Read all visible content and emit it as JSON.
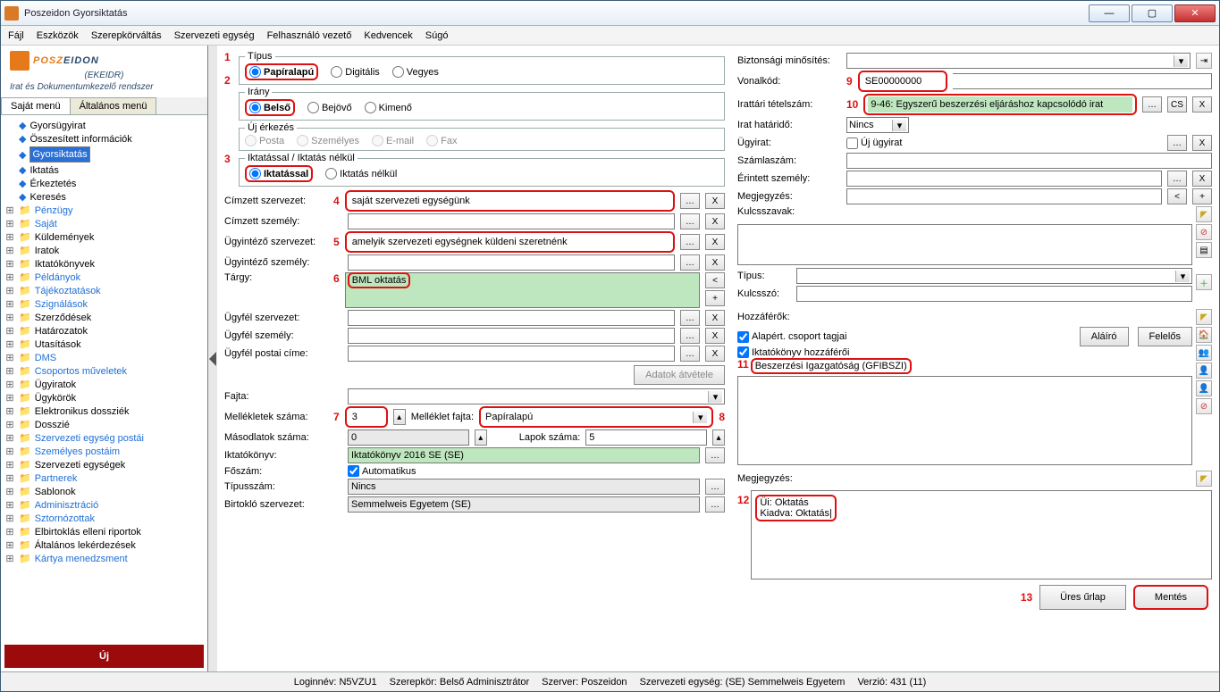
{
  "window": {
    "title": "Poszeidon Gyorsiktatás"
  },
  "menu": {
    "fajl": "Fájl",
    "eszkozok": "Eszközök",
    "szerepkor": "Szerepkörváltás",
    "szervegy": "Szervezeti egység",
    "felhvez": "Felhasználó vezető",
    "kedvenc": "Kedvencek",
    "sugo": "Súgó"
  },
  "brand": {
    "posz": "POSZ",
    "eidon": "EIDON",
    "ekeidr": "(EKEIDR)",
    "sub": "Irat és Dokumentumkezelő rendszer"
  },
  "tabs": {
    "sajat": "Saját menü",
    "alt": "Általános menü"
  },
  "tree": {
    "items": [
      {
        "exp": "",
        "icon": "dia",
        "label": "Gyorsügyirat",
        "blue": false
      },
      {
        "exp": "",
        "icon": "dia",
        "label": "Összesített információk",
        "blue": false
      },
      {
        "exp": "",
        "icon": "dia",
        "label": "Gyorsiktatás",
        "sel": true
      },
      {
        "exp": "",
        "icon": "dia",
        "label": "Iktatás",
        "blue": false
      },
      {
        "exp": "",
        "icon": "dia",
        "label": "Érkeztetés",
        "blue": false
      },
      {
        "exp": "",
        "icon": "dia",
        "label": "Keresés",
        "blue": false
      },
      {
        "exp": "+",
        "icon": "folder",
        "label": "Pénzügy",
        "blue": true
      },
      {
        "exp": "+",
        "icon": "folder",
        "label": "Saját",
        "blue": true
      },
      {
        "exp": "+",
        "icon": "folder",
        "label": "Küldemények",
        "blue": false
      },
      {
        "exp": "+",
        "icon": "folder",
        "label": "Iratok",
        "blue": false
      },
      {
        "exp": "+",
        "icon": "folder",
        "label": "Iktatókönyvek",
        "blue": false
      },
      {
        "exp": "+",
        "icon": "folder",
        "label": "Példányok",
        "blue": true
      },
      {
        "exp": "+",
        "icon": "folder",
        "label": "Tájékoztatások",
        "blue": true
      },
      {
        "exp": "+",
        "icon": "folder",
        "label": "Szignálások",
        "blue": true
      },
      {
        "exp": "+",
        "icon": "folder",
        "label": "Szerződések",
        "blue": false
      },
      {
        "exp": "+",
        "icon": "folder",
        "label": "Határozatok",
        "blue": false
      },
      {
        "exp": "+",
        "icon": "folder",
        "label": "Utasítások",
        "blue": false
      },
      {
        "exp": "+",
        "icon": "folder",
        "label": "DMS",
        "blue": true
      },
      {
        "exp": "+",
        "icon": "folder",
        "label": "Csoportos műveletek",
        "blue": true
      },
      {
        "exp": "+",
        "icon": "folder",
        "label": "Ügyiratok",
        "blue": false
      },
      {
        "exp": "+",
        "icon": "folder",
        "label": "Ügykörök",
        "blue": false
      },
      {
        "exp": "+",
        "icon": "folder",
        "label": "Elektronikus dossziék",
        "blue": false
      },
      {
        "exp": "+",
        "icon": "folder",
        "label": "Dosszié",
        "blue": false
      },
      {
        "exp": "+",
        "icon": "folder",
        "label": "Szervezeti egység postái",
        "blue": true
      },
      {
        "exp": "+",
        "icon": "folder",
        "label": "Személyes postáim",
        "blue": true
      },
      {
        "exp": "+",
        "icon": "folder",
        "label": "Szervezeti egységek",
        "blue": false
      },
      {
        "exp": "+",
        "icon": "folder",
        "label": "Partnerek",
        "blue": true
      },
      {
        "exp": "+",
        "icon": "folder",
        "label": "Sablonok",
        "blue": false
      },
      {
        "exp": "+",
        "icon": "folder",
        "label": "Adminisztráció",
        "blue": true
      },
      {
        "exp": "+",
        "icon": "folder",
        "label": "Sztornózottak",
        "blue": true
      },
      {
        "exp": "+",
        "icon": "folder",
        "label": "Elbirtoklás elleni riportok",
        "blue": false
      },
      {
        "exp": "+",
        "icon": "folder",
        "label": "Általános lekérdezések",
        "blue": false
      },
      {
        "exp": "+",
        "icon": "folder",
        "label": "Kártya menedzsment",
        "blue": true
      }
    ]
  },
  "uj": "Új",
  "groups": {
    "tipus": {
      "legend": "Típus",
      "pap": "Papíralapú",
      "dig": "Digitális",
      "vegy": "Vegyes"
    },
    "irany": {
      "legend": "Irány",
      "belso": "Belső",
      "bejovo": "Bejövő",
      "kimeno": "Kimenő"
    },
    "ujerk": {
      "legend": "Új érkezés",
      "posta": "Posta",
      "szem": "Személyes",
      "email": "E-mail",
      "fax": "Fax"
    },
    "ikt": {
      "legend": "Iktatással / Iktatás nélkül",
      "iktatassal": "Iktatással",
      "nelkul": "Iktatás nélkül"
    }
  },
  "left": {
    "cimzett_szerv": "Címzett szervezet:",
    "cimzett_szerv_v": "saját szervezeti egységünk",
    "cimzett_szem": "Címzett személy:",
    "ugy_szerv": "Ügyintéző szervezet:",
    "ugy_szerv_v": "amelyik szervezeti egységnek küldeni szeretnénk",
    "ugy_szem": "Ügyintéző személy:",
    "targy": "Tárgy:",
    "targy_v": "BML oktatás",
    "ugyfel_sz": "Ügyfél szervezet:",
    "ugyfel_szem": "Ügyfél személy:",
    "ugyfel_posta": "Ügyfél postai címe:",
    "adatok": "Adatok átvétele",
    "fajta": "Fajta:",
    "mell_sz": "Mellékletek száma:",
    "mell_sz_v": "3",
    "mell_fajta": "Melléklet fajta:",
    "mell_fajta_v": "Papíralapú",
    "masod": "Másodlatok száma:",
    "masod_v": "0",
    "lapok": "Lapok száma:",
    "lapok_v": "5",
    "iktkonyv": "Iktatókönyv:",
    "iktkonyv_v": "Iktatókönyv 2016 SE (SE)",
    "foszam": "Főszám:",
    "auto": "Automatikus",
    "tipusszam": "Típusszám:",
    "tipusszam_v": "Nincs",
    "birtoklo": "Birtokló szervezet:",
    "birtoklo_v": "Semmelweis Egyetem (SE)"
  },
  "right": {
    "bizt": "Biztonsági minősítés:",
    "vonal": "Vonalkód:",
    "vonal_v": "SE00000000",
    "irattet": "Irattári tételszám:",
    "irattet_v": "9-46: Egyszerű beszerzési eljáráshoz kapcsolódó irat",
    "cs": "CS",
    "x": "X",
    "irathat": "Irat határidő:",
    "irathat_v": "Nincs",
    "ugyirat": "Ügyirat:",
    "ujugy": "Új ügyirat",
    "szamla": "Számlaszám:",
    "erintett": "Érintett személy:",
    "megj": "Megjegyzés:",
    "kulcssz": "Kulcsszavak:",
    "tipus": "Típus:",
    "kulcsszo": "Kulcsszó:",
    "hozza": "Hozzáférők:",
    "alap": "Alapért. csoport tagjai",
    "ikthozz": "Iktatókönyv hozzáférői",
    "alairo": "Aláíró",
    "felelos": "Felelős",
    "hozzaentry": "Beszerzési Igazgatóság (GFIBSZI)",
    "megj2": "Megjegyzés:",
    "note1": "Üi: Oktatás",
    "note2": "Kiadva: Oktatás|",
    "ures": "Üres űrlap",
    "mentes": "Mentés"
  },
  "annot": {
    "n1": "1",
    "n2": "2",
    "n3": "3",
    "n4": "4",
    "n5": "5",
    "n6": "6",
    "n7": "7",
    "n8": "8",
    "n9": "9",
    "n10": "10",
    "n11": "11",
    "n12": "12",
    "n13": "13"
  },
  "status": {
    "login": "Loginnév: N5VZU1",
    "szerep": "Szerepkör: Belső Adminisztrátor",
    "szerver": "Szerver: Poszeidon",
    "szerv": "Szervezeti egység: (SE) Semmelweis Egyetem",
    "verzio": "Verzió: 431 (11)"
  }
}
